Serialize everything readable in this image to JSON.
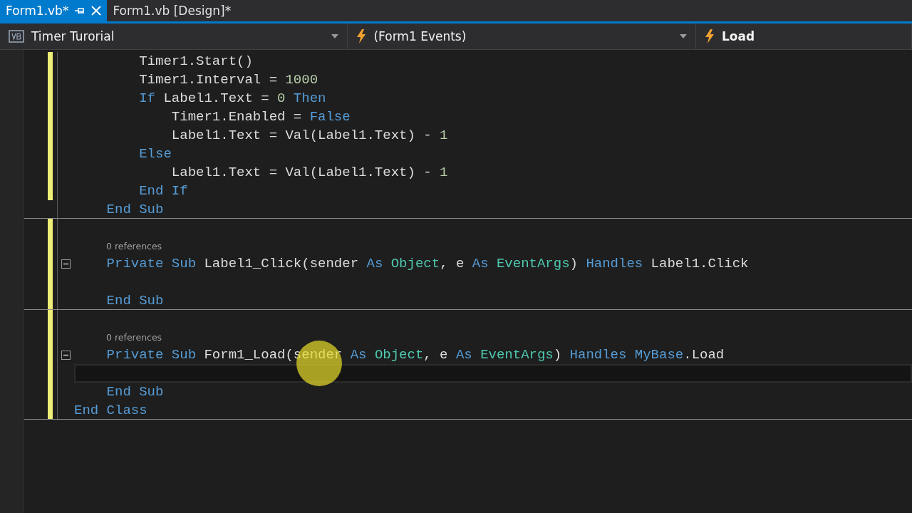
{
  "tabs": [
    {
      "label": "Form1.vb*",
      "selected": true
    },
    {
      "label": "Form1.vb [Design]*",
      "selected": false
    }
  ],
  "nav_bar": [
    {
      "label": "Timer Turorial",
      "kind": "project"
    },
    {
      "label": "(Form1 Events)",
      "kind": "events"
    },
    {
      "label": "Load",
      "kind": "member"
    }
  ],
  "lines": [
    {
      "kind": "code",
      "changed": true,
      "tokens": [
        {
          "text": "        Timer1.Start()",
          "kind": "plain"
        }
      ]
    },
    {
      "kind": "code",
      "changed": true,
      "tokens": [
        {
          "text": "        Timer1.Interval = ",
          "kind": "plain"
        },
        {
          "text": "1000",
          "kind": "number"
        }
      ]
    },
    {
      "kind": "code",
      "changed": true,
      "tokens": [
        {
          "text": "        If",
          "kind": "keyword"
        },
        {
          "text": " Label1.Text = ",
          "kind": "plain"
        },
        {
          "text": "0",
          "kind": "number"
        },
        {
          "text": " Then",
          "kind": "keyword"
        }
      ]
    },
    {
      "kind": "code",
      "changed": true,
      "tokens": [
        {
          "text": "            Timer1.Enabled = ",
          "kind": "plain"
        },
        {
          "text": "False",
          "kind": "keyword"
        }
      ]
    },
    {
      "kind": "code",
      "changed": true,
      "tokens": [
        {
          "text": "            Label1.Text = Val(Label1.Text) - ",
          "kind": "plain"
        },
        {
          "text": "1",
          "kind": "number"
        }
      ]
    },
    {
      "kind": "code",
      "changed": true,
      "tokens": [
        {
          "text": "        Else",
          "kind": "keyword"
        }
      ]
    },
    {
      "kind": "code",
      "changed": true,
      "tokens": [
        {
          "text": "            Label1.Text = Val(Label1.Text) - ",
          "kind": "plain"
        },
        {
          "text": "1",
          "kind": "number"
        }
      ]
    },
    {
      "kind": "code",
      "changed": true,
      "tokens": [
        {
          "text": "        End If",
          "kind": "keyword"
        }
      ]
    },
    {
      "kind": "code",
      "changed": false,
      "separator_after": true,
      "tokens": [
        {
          "text": "    End Sub",
          "kind": "keyword"
        }
      ]
    },
    {
      "kind": "blank",
      "changed": true
    },
    {
      "kind": "codelens",
      "changed": true,
      "text": "0 references"
    },
    {
      "kind": "code",
      "changed": true,
      "collapsible": true,
      "tokens": [
        {
          "text": "    Private Sub",
          "kind": "keyword"
        },
        {
          "text": " Label1_Click(sender ",
          "kind": "plain"
        },
        {
          "text": "As",
          "kind": "keyword"
        },
        {
          "text": " Object",
          "kind": "type"
        },
        {
          "text": ", e ",
          "kind": "plain"
        },
        {
          "text": "As",
          "kind": "keyword"
        },
        {
          "text": " EventArgs",
          "kind": "type"
        },
        {
          "text": ") ",
          "kind": "plain"
        },
        {
          "text": "Handles",
          "kind": "keyword"
        },
        {
          "text": " Label1.Click",
          "kind": "plain"
        }
      ]
    },
    {
      "kind": "blank",
      "changed": true
    },
    {
      "kind": "code",
      "changed": true,
      "separator_after": true,
      "tokens": [
        {
          "text": "    End Sub",
          "kind": "keyword"
        }
      ]
    },
    {
      "kind": "blank",
      "changed": true
    },
    {
      "kind": "codelens",
      "changed": true,
      "text": "0 references"
    },
    {
      "kind": "code",
      "changed": true,
      "collapsible": true,
      "tokens": [
        {
          "text": "    Private Sub",
          "kind": "keyword"
        },
        {
          "text": " Form1_Load(sender ",
          "kind": "plain"
        },
        {
          "text": "As",
          "kind": "keyword"
        },
        {
          "text": " Object",
          "kind": "type"
        },
        {
          "text": ", e ",
          "kind": "plain"
        },
        {
          "text": "As",
          "kind": "keyword"
        },
        {
          "text": " EventArgs",
          "kind": "type"
        },
        {
          "text": ") ",
          "kind": "plain"
        },
        {
          "text": "Handles",
          "kind": "keyword"
        },
        {
          "text": " MyBase",
          "kind": "keyword"
        },
        {
          "text": ".Load",
          "kind": "plain"
        }
      ]
    },
    {
      "kind": "blank",
      "changed": true,
      "current": true
    },
    {
      "kind": "code",
      "changed": true,
      "tokens": [
        {
          "text": "    End Sub",
          "kind": "keyword"
        }
      ]
    },
    {
      "kind": "code",
      "changed": true,
      "separator_after": true,
      "tokens": [
        {
          "text": "End Class",
          "kind": "keyword"
        }
      ]
    }
  ]
}
